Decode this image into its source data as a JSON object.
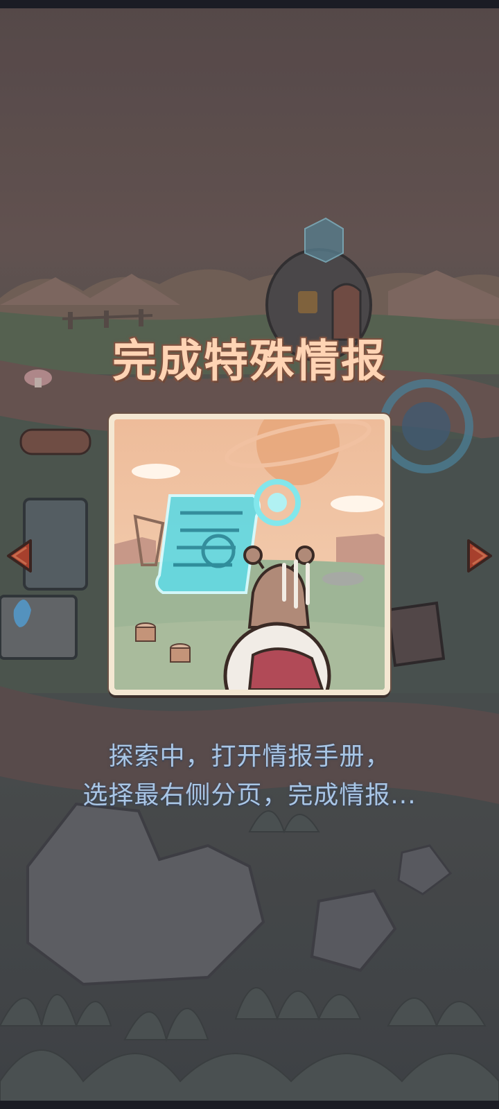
{
  "screen": {
    "title": "完成特殊情报",
    "description_line1": "探索中，打开情报手册，",
    "description_line2": "选择最右侧分页，完成情报...",
    "prev_icon": "triangle-left-icon",
    "next_icon": "triangle-right-icon"
  },
  "colors": {
    "title": "#ffd4b4",
    "description": "#a9c6e6",
    "arrow": "#a7402d",
    "card_border": "#f4e7d2"
  }
}
